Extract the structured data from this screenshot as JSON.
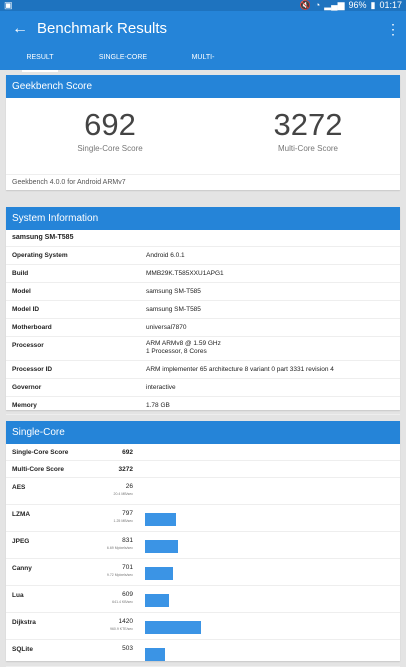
{
  "status_bar": {
    "time": "01:17",
    "battery": "96%",
    "icons": [
      "screenshot-icon",
      "mute-icon",
      "wifi-icon",
      "signal-icon",
      "battery-icon"
    ]
  },
  "app_bar": {
    "title": "Benchmark Results"
  },
  "tabs": [
    {
      "label": "RESULT",
      "active": true
    },
    {
      "label": "SINGLE-CORE",
      "active": false
    },
    {
      "label": "MULTI-CORE",
      "active": false
    }
  ],
  "geekbench": {
    "header": "Geekbench Score",
    "single_score": "692",
    "single_label": "Single-Core Score",
    "multi_score": "3272",
    "multi_label": "Multi-Core Score",
    "version": "Geekbench 4.0.0 for Android ARMv7"
  },
  "system": {
    "header": "System Information",
    "device": "samsung SM-T585",
    "rows": [
      {
        "k": "Operating System",
        "v": "Android 6.0.1"
      },
      {
        "k": "Build",
        "v": "MMB29K.T585XXU1APG1"
      },
      {
        "k": "Model",
        "v": "samsung SM-T585"
      },
      {
        "k": "Model ID",
        "v": "samsung SM-T585"
      },
      {
        "k": "Motherboard",
        "v": "universal7870"
      },
      {
        "k": "Processor",
        "v": "ARM ARMv8 @ 1.59 GHz",
        "v2": "1 Processor, 8 Cores"
      },
      {
        "k": "Processor ID",
        "v": "ARM implementer 65 architecture 8 variant 0 part 3331 revision 4"
      },
      {
        "k": "Governor",
        "v": "interactive"
      },
      {
        "k": "Memory",
        "v": "1.78 GB"
      }
    ]
  },
  "single_core": {
    "header": "Single-Core",
    "summary": [
      {
        "k": "Single-Core Score",
        "v": "692"
      },
      {
        "k": "Multi-Core Score",
        "v": "3272"
      }
    ],
    "tests": [
      {
        "k": "AES",
        "v": "26",
        "sub": "20.4 MB/sec",
        "bar": 26
      },
      {
        "k": "LZMA",
        "v": "797",
        "sub": "1.25 MB/sec",
        "bar": 797
      },
      {
        "k": "JPEG",
        "v": "831",
        "sub": "6.69 Mpixels/sec",
        "bar": 831
      },
      {
        "k": "Canny",
        "v": "701",
        "sub": "9.72 Mpixels/sec",
        "bar": 701
      },
      {
        "k": "Lua",
        "v": "609",
        "sub": "641.4 KB/sec",
        "bar": 609
      },
      {
        "k": "Dijkstra",
        "v": "1420",
        "sub": "960.9 KTE/sec",
        "bar": 1420
      },
      {
        "k": "SQLite",
        "v": "503",
        "sub": "",
        "bar": 503
      }
    ]
  },
  "colors": {
    "accent": "#2584d8",
    "statusbar": "#1e73bf",
    "bar": "#3b94e5"
  }
}
